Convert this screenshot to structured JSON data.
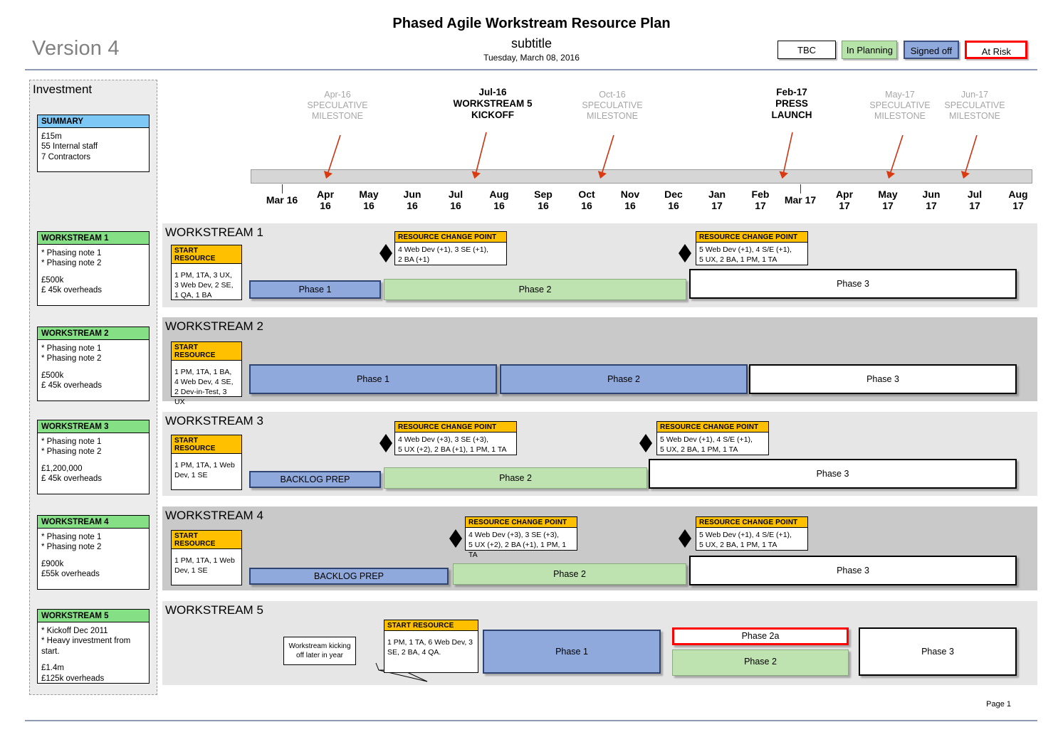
{
  "header": {
    "version": "Version 4",
    "title": "Phased Agile Workstream Resource Plan",
    "subtitle": "subtitle",
    "date": "Tuesday, March 08, 2016",
    "page": "Page 1"
  },
  "legend": {
    "tbc": "TBC",
    "in_planning": "In Planning",
    "signed_off": "Signed off",
    "at_risk": "At Risk",
    "colors": {
      "in_planning": "#b5e3a8",
      "signed_off": "#8fa9dd",
      "at_risk": "#ff0000",
      "tbc": "#ffffff",
      "note_head": "#ffc000",
      "summary_head": "#7ec8f5",
      "ws_head": "#85e085"
    }
  },
  "investment": {
    "title": "Investment",
    "summary": {
      "head": "SUMMARY",
      "lines": [
        "£15m",
        "55 Internal staff",
        "7 Contractors"
      ]
    },
    "cards": [
      {
        "head": "WORKSTREAM 1",
        "notes": [
          "* Phasing note 1",
          "* Phasing note 2"
        ],
        "costs": [
          "£500k",
          "£ 45k overheads"
        ]
      },
      {
        "head": "WORKSTREAM 2",
        "notes": [
          "* Phasing note 1",
          "* Phasing note 2"
        ],
        "costs": [
          "£500k",
          "£ 45k overheads"
        ]
      },
      {
        "head": "WORKSTREAM 3",
        "notes": [
          "* Phasing note 1",
          "* Phasing note 2"
        ],
        "costs": [
          "£1,200,000",
          "£ 45k overheads"
        ]
      },
      {
        "head": "WORKSTREAM 4",
        "notes": [
          "* Phasing note 1",
          "* Phasing note 2"
        ],
        "costs": [
          "£900k",
          "£55k overheads"
        ]
      },
      {
        "head": "WORKSTREAM 5",
        "notes": [
          "* Kickoff Dec 2011",
          "* Heavy investment from start."
        ],
        "costs": [
          "£1.4m",
          "£125k overheads"
        ]
      }
    ]
  },
  "timeline": {
    "months": [
      {
        "m": "Mar 16",
        "y": ""
      },
      {
        "m": "Apr",
        "y": "16"
      },
      {
        "m": "May",
        "y": "16"
      },
      {
        "m": "Jun",
        "y": "16"
      },
      {
        "m": "Jul",
        "y": "16"
      },
      {
        "m": "Aug",
        "y": "16"
      },
      {
        "m": "Sep",
        "y": "16"
      },
      {
        "m": "Oct",
        "y": "16"
      },
      {
        "m": "Nov",
        "y": "16"
      },
      {
        "m": "Dec",
        "y": "16"
      },
      {
        "m": "Jan",
        "y": "17"
      },
      {
        "m": "Feb",
        "y": "17"
      },
      {
        "m": "Mar 17",
        "y": ""
      },
      {
        "m": "Apr",
        "y": "17"
      },
      {
        "m": "May",
        "y": "17"
      },
      {
        "m": "Jun",
        "y": "17"
      },
      {
        "m": "Jul",
        "y": "17"
      },
      {
        "m": "Aug",
        "y": "17"
      }
    ],
    "milestones": [
      {
        "date": "Apr-16",
        "l1": "SPECULATIVE",
        "l2": "MILESTONE",
        "emphasis": "speculative"
      },
      {
        "date": "Jul-16",
        "l1": "WORKSTREAM 5",
        "l2": "KICKOFF",
        "emphasis": "bold"
      },
      {
        "date": "Oct-16",
        "l1": "SPECULATIVE",
        "l2": "MILESTONE",
        "emphasis": "speculative"
      },
      {
        "date": "Feb-17",
        "l1": "PRESS",
        "l2": "LAUNCH",
        "emphasis": "bold"
      },
      {
        "date": "May-17",
        "l1": "SPECULATIVE",
        "l2": "MILESTONE",
        "emphasis": "speculative"
      },
      {
        "date": "Jun-17",
        "l1": "SPECULATIVE",
        "l2": "MILESTONE",
        "emphasis": "speculative"
      }
    ]
  },
  "workstreams": [
    {
      "heading": "WORKSTREAM 1",
      "start_resource": {
        "head": "START RESOURCE",
        "lines": [
          "1 PM, 1TA, 3 UX,",
          "3 Web Dev, 2 SE,",
          "1 QA, 1 BA"
        ]
      },
      "change_points": [
        {
          "head": "RESOURCE CHANGE POINT",
          "lines": [
            "4 Web Dev (+1), 3 SE (+1),",
            "2 BA (+1)"
          ]
        },
        {
          "head": "RESOURCE CHANGE POINT",
          "lines": [
            "5 Web Dev (+1), 4 S/E (+1),",
            "5 UX, 2 BA, 1 PM, 1 TA"
          ]
        }
      ],
      "bars": [
        {
          "label": "Phase 1",
          "style": "blue"
        },
        {
          "label": "Phase 2",
          "style": "green"
        },
        {
          "label": "Phase 3",
          "style": "white"
        }
      ]
    },
    {
      "heading": "WORKSTREAM 2",
      "start_resource": {
        "head": "START RESOURCE",
        "lines": [
          "1 PM, 1TA, 1 BA,",
          "4 Web Dev, 4 SE,",
          "2 Dev-in-Test, 3 UX"
        ]
      },
      "change_points": [],
      "bars": [
        {
          "label": "Phase 1",
          "style": "blue"
        },
        {
          "label": "Phase 2",
          "style": "blue"
        },
        {
          "label": "Phase 3",
          "style": "white"
        }
      ]
    },
    {
      "heading": "WORKSTREAM 3",
      "start_resource": {
        "head": "START RESOURCE",
        "lines": [
          "1 PM, 1TA, 1 Web",
          "Dev, 1 SE"
        ]
      },
      "change_points": [
        {
          "head": "RESOURCE CHANGE POINT",
          "lines": [
            "4 Web Dev (+3), 3 SE (+3),",
            "5 UX (+2), 2 BA (+1), 1 PM, 1 TA"
          ]
        },
        {
          "head": "RESOURCE CHANGE POINT",
          "lines": [
            "5 Web Dev (+1), 4 S/E (+1),",
            "5 UX, 2 BA, 1 PM, 1 TA"
          ]
        }
      ],
      "bars": [
        {
          "label": "BACKLOG PREP",
          "style": "blue"
        },
        {
          "label": "Phase 2",
          "style": "green"
        },
        {
          "label": "Phase 3",
          "style": "white"
        }
      ]
    },
    {
      "heading": "WORKSTREAM 4",
      "start_resource": {
        "head": "START RESOURCE",
        "lines": [
          "1 PM, 1TA, 1 Web",
          "Dev, 1 SE"
        ]
      },
      "change_points": [
        {
          "head": "RESOURCE CHANGE POINT",
          "lines": [
            "4 Web Dev (+3), 3 SE (+3),",
            "5 UX (+2), 2 BA (+1), 1 PM, 1 TA"
          ]
        },
        {
          "head": "RESOURCE CHANGE POINT",
          "lines": [
            "5 Web Dev (+1), 4 S/E (+1),",
            "5 UX, 2 BA, 1 PM, 1 TA"
          ]
        }
      ],
      "bars": [
        {
          "label": "BACKLOG PREP",
          "style": "blue"
        },
        {
          "label": "Phase 2",
          "style": "green"
        },
        {
          "label": "Phase 3",
          "style": "white"
        }
      ]
    },
    {
      "heading": "WORKSTREAM 5",
      "callout": "Workstream kicking off later in year",
      "start_resource": {
        "head": "START RESOURCE",
        "lines": [
          "1 PM, 1 TA, 6 Web Dev, 3",
          "SE, 2 BA, 4 QA."
        ]
      },
      "change_points": [],
      "bars": [
        {
          "label": "Phase 1",
          "style": "blue"
        },
        {
          "label": "Phase 2a",
          "style": "risk"
        },
        {
          "label": "Phase 2",
          "style": "green"
        },
        {
          "label": "Phase 3",
          "style": "white"
        }
      ]
    }
  ]
}
